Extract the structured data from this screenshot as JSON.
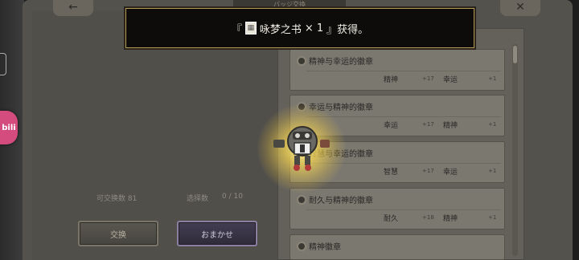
{
  "header": {
    "title": "バッジ交換",
    "back_glyph": "←",
    "close_glyph": "✕"
  },
  "toast": {
    "open_bracket": "『",
    "item_name": "咏梦之书",
    "quantity": "× 1",
    "suffix": "』获得。"
  },
  "side_button": {
    "label": "bili"
  },
  "counters": {
    "exchangeable": "可交换数 81",
    "selected_label": "选择数",
    "selected_value": "0 /  10"
  },
  "buttons": {
    "trade": "交换",
    "auto": "おまかせ"
  },
  "badges": [
    {
      "name": "精神与幸运的徽章",
      "stat1": "精神",
      "val1": "+17",
      "stat2": "幸运",
      "val2": "+1"
    },
    {
      "name": "幸运与精神的徽章",
      "stat1": "幸运",
      "val1": "+17",
      "stat2": "精神",
      "val2": "+1"
    },
    {
      "name": "智慧与幸运的徽章",
      "stat1": "智慧",
      "val1": "+17",
      "stat2": "幸运",
      "val2": "+1"
    },
    {
      "name": "耐久与精神的徽章",
      "stat1": "耐久",
      "val1": "+18",
      "stat2": "精神",
      "val2": "+1"
    },
    {
      "name": "精神徽章",
      "stat1": "",
      "val1": "",
      "stat2": "",
      "val2": ""
    }
  ],
  "colors": {
    "accent_gold": "#b59a55",
    "glow": "#ffe66e",
    "side_button": "#d44b7d"
  }
}
